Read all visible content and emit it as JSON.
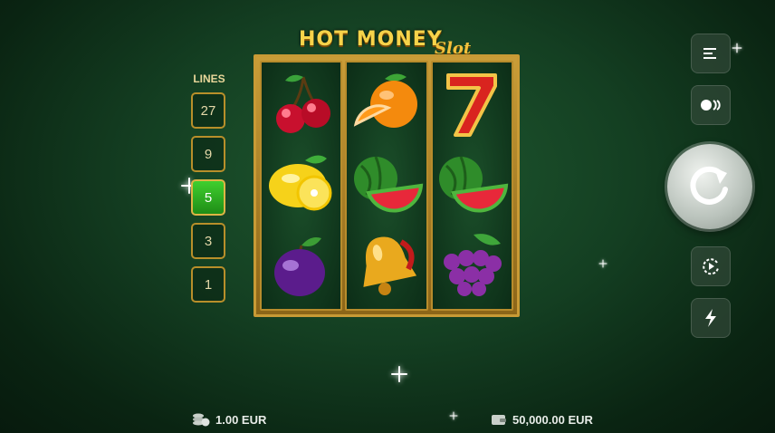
{
  "game": {
    "logo_main": "HOT MONEY",
    "logo_sub": "Slot"
  },
  "lines": {
    "title": "LINES",
    "options": [
      "27",
      "9",
      "5",
      "3",
      "1"
    ],
    "selected": "5"
  },
  "reels": [
    [
      "cherry-icon",
      "lemon-icon",
      "plum-icon"
    ],
    [
      "orange-icon",
      "watermelon-icon",
      "bell-icon"
    ],
    [
      "seven-icon",
      "watermelon-icon",
      "grapes-icon"
    ]
  ],
  "controls": {
    "menu": "menu-icon",
    "speed": "speed-icon",
    "spin": "spin-icon",
    "autoplay": "autoplay-icon",
    "turbo": "turbo-icon"
  },
  "footer": {
    "bet": "1.00 EUR",
    "balance": "50,000.00 EUR"
  },
  "colors": {
    "background": "#143f22",
    "gold": "#c89a35",
    "active_line": "#3fcf2e"
  }
}
